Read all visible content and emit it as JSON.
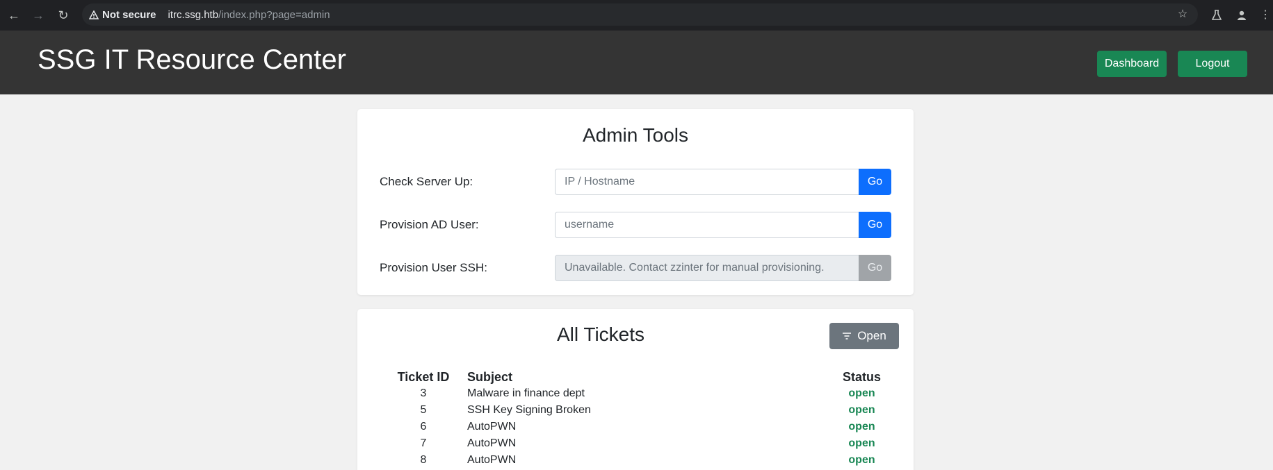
{
  "browser": {
    "security_label": "Not secure",
    "url_host": "itrc.ssg.htb",
    "url_path": "/index.php?page=admin"
  },
  "header": {
    "title": "SSG IT Resource Center",
    "dashboard_label": "Dashboard",
    "logout_label": "Logout"
  },
  "admin": {
    "title": "Admin Tools",
    "rows": [
      {
        "label": "Check Server Up:",
        "placeholder": "IP / Hostname",
        "button": "Go"
      },
      {
        "label": "Provision AD User:",
        "placeholder": "username",
        "button": "Go"
      },
      {
        "label": "Provision User SSH:",
        "placeholder": "Unavailable. Contact zzinter for manual provisioning.",
        "button": "Go"
      }
    ]
  },
  "tickets": {
    "title": "All Tickets",
    "filter_label": "Open",
    "columns": [
      "Ticket ID",
      "Subject",
      "Status"
    ],
    "rows": [
      {
        "id": "3",
        "subject": "Malware in finance dept",
        "status": "open"
      },
      {
        "id": "5",
        "subject": "SSH Key Signing Broken",
        "status": "open"
      },
      {
        "id": "6",
        "subject": "AutoPWN",
        "status": "open"
      },
      {
        "id": "7",
        "subject": "AutoPWN",
        "status": "open"
      },
      {
        "id": "8",
        "subject": "AutoPWN",
        "status": "open"
      }
    ]
  },
  "colors": {
    "header_bg": "#343434",
    "success": "#198754",
    "primary": "#0d6efd",
    "secondary": "#6c757d"
  },
  "icons": [
    "back-icon",
    "forward-icon",
    "reload-icon",
    "warning-icon",
    "star-icon",
    "labs-icon",
    "profile-icon",
    "menu-icon",
    "filter-icon"
  ]
}
